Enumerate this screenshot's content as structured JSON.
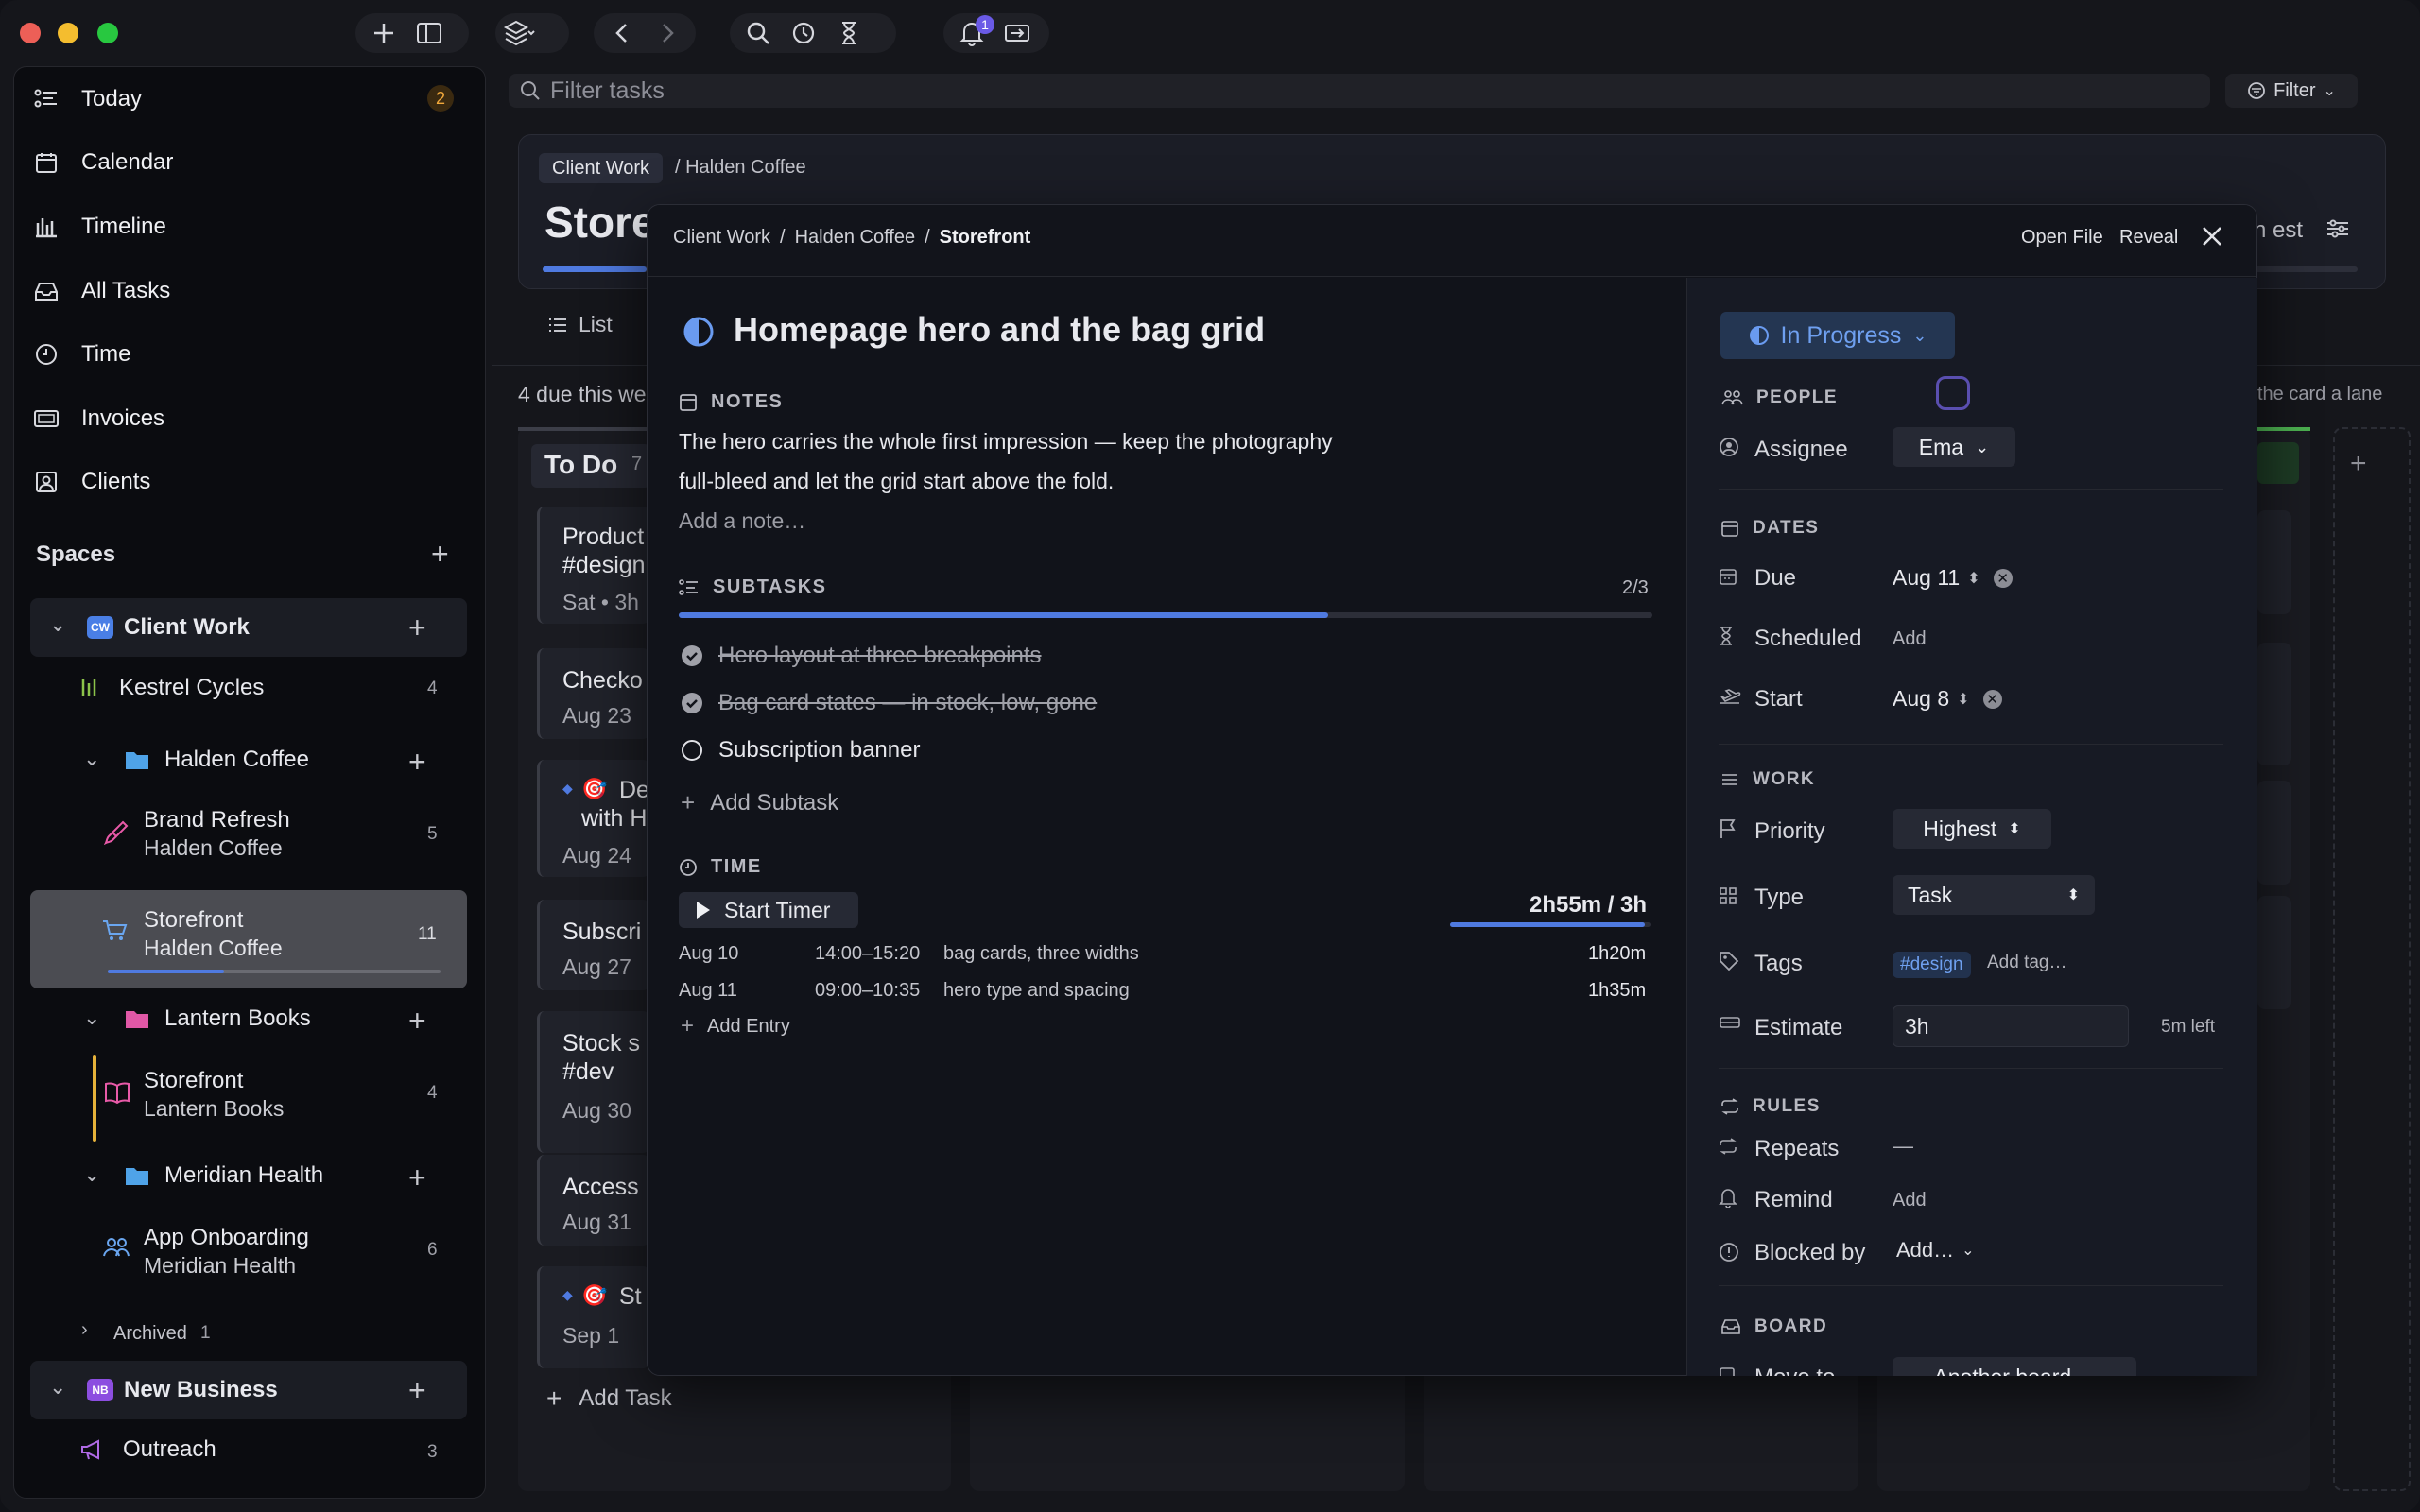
{
  "toolbar": {
    "notification_count": "1"
  },
  "sidebar": {
    "nav": [
      {
        "label": "Today",
        "icon": "checklist-icon",
        "badge": "2"
      },
      {
        "label": "Calendar",
        "icon": "calendar-icon"
      },
      {
        "label": "Timeline",
        "icon": "timeline-icon"
      },
      {
        "label": "All Tasks",
        "icon": "tray-icon"
      },
      {
        "label": "Time",
        "icon": "clock-icon"
      },
      {
        "label": "Invoices",
        "icon": "invoice-icon"
      },
      {
        "label": "Clients",
        "icon": "contact-icon"
      }
    ],
    "spaces_title": "Spaces",
    "client_work": {
      "initials": "CW",
      "label": "Client Work"
    },
    "kestrel": {
      "label": "Kestrel Cycles",
      "count": "4"
    },
    "halden_folder": {
      "label": "Halden Coffee"
    },
    "brand_refresh": {
      "title": "Brand Refresh",
      "subtitle": "Halden Coffee",
      "count": "5"
    },
    "storefront_halden": {
      "title": "Storefront",
      "subtitle": "Halden Coffee",
      "count": "11",
      "progress": 0.35
    },
    "lantern_folder": {
      "label": "Lantern Books"
    },
    "storefront_lantern": {
      "title": "Storefront",
      "subtitle": "Lantern Books",
      "count": "4"
    },
    "meridian_folder": {
      "label": "Meridian Health"
    },
    "app_onboarding": {
      "title": "App Onboarding",
      "subtitle": "Meridian Health",
      "count": "6"
    },
    "archived": {
      "label": "Archived",
      "count": "1"
    },
    "new_business": {
      "initials": "NB",
      "label": "New Business"
    },
    "outreach": {
      "label": "Outreach",
      "count": "3"
    }
  },
  "main": {
    "filter_placeholder": "Filter tasks",
    "filter_button": "Filter",
    "breadcrumb": [
      "Client Work",
      "/ Halden Coffee"
    ],
    "project_title_partial": "Store",
    "right_partial": "n est",
    "view_tab": "List",
    "due_partial": "4 due this we",
    "lane_hint": "the card a lane",
    "todo": {
      "label": "To Do",
      "count": "7"
    },
    "cards": [
      {
        "line1": "Product",
        "line2": "#design",
        "date": "Sat • 3h"
      },
      {
        "line1": "Checko",
        "date": "Aug 23"
      },
      {
        "line1": "De",
        "line2": "with H",
        "date": "Aug 24"
      },
      {
        "line1": "Subscri",
        "date": "Aug 27"
      },
      {
        "line1": "Stock s",
        "line2": "#dev",
        "date": "Aug 30"
      },
      {
        "line1": "Access",
        "date": "Aug 31"
      },
      {
        "line1": "St",
        "date": "Sep 1"
      }
    ],
    "add_task": "Add Task"
  },
  "modal": {
    "breadcrumb": {
      "a": "Client Work",
      "b": "Halden Coffee",
      "c": "Storefront"
    },
    "open_file": "Open File",
    "reveal": "Reveal",
    "title": "Homepage hero and the bag grid",
    "notes_label": "NOTES",
    "notes_line1": "The hero carries the whole first impression — keep the photography",
    "notes_line2": "full-bleed and let the grid start above the fold.",
    "add_note": "Add a note…",
    "subtasks_label": "SUBTASKS",
    "subtasks_count": "2/3",
    "subtasks_progress": 0.667,
    "subtasks": [
      {
        "label": "Hero layout at three breakpoints",
        "done": true
      },
      {
        "label": "Bag card states — in stock, low, gone",
        "done": true
      },
      {
        "label": "Subscription banner",
        "done": false
      }
    ],
    "add_subtask": "Add Subtask",
    "time_label": "TIME",
    "start_timer": "Start Timer",
    "time_total": "2h55m / 3h",
    "time_progress": 0.97,
    "entries": [
      {
        "date": "Aug 10",
        "range": "14:00–15:20",
        "note": "bag cards, three widths",
        "dur": "1h20m"
      },
      {
        "date": "Aug 11",
        "range": "09:00–10:35",
        "note": "hero type and spacing",
        "dur": "1h35m"
      }
    ],
    "add_entry": "Add Entry",
    "status": "In Progress",
    "people_label": "PEOPLE",
    "assignee_label": "Assignee",
    "assignee": "Ema",
    "dates_label": "DATES",
    "due_label": "Due",
    "due": "Aug 11",
    "scheduled_label": "Scheduled",
    "scheduled_add": "Add",
    "start_label": "Start",
    "start": "Aug 8",
    "work_label": "WORK",
    "priority_label": "Priority",
    "priority": "Highest",
    "type_label": "Type",
    "type": "Task",
    "tags_label": "Tags",
    "tag": "#design",
    "add_tag": "Add tag…",
    "estimate_label": "Estimate",
    "estimate": "3h",
    "estimate_left": "5m left",
    "rules_label": "RULES",
    "repeats_label": "Repeats",
    "repeats": "—",
    "remind_label": "Remind",
    "remind_add": "Add",
    "blocked_label": "Blocked by",
    "blocked_add": "Add…",
    "board_label": "BOARD",
    "move_to_label": "Move to",
    "move_to": "Another board"
  },
  "colors": {
    "accent": "#4f7ae0",
    "badge": "#f2a93b",
    "cw_badge": "#4a7fe6",
    "nb_badge": "#8c4ee0"
  }
}
